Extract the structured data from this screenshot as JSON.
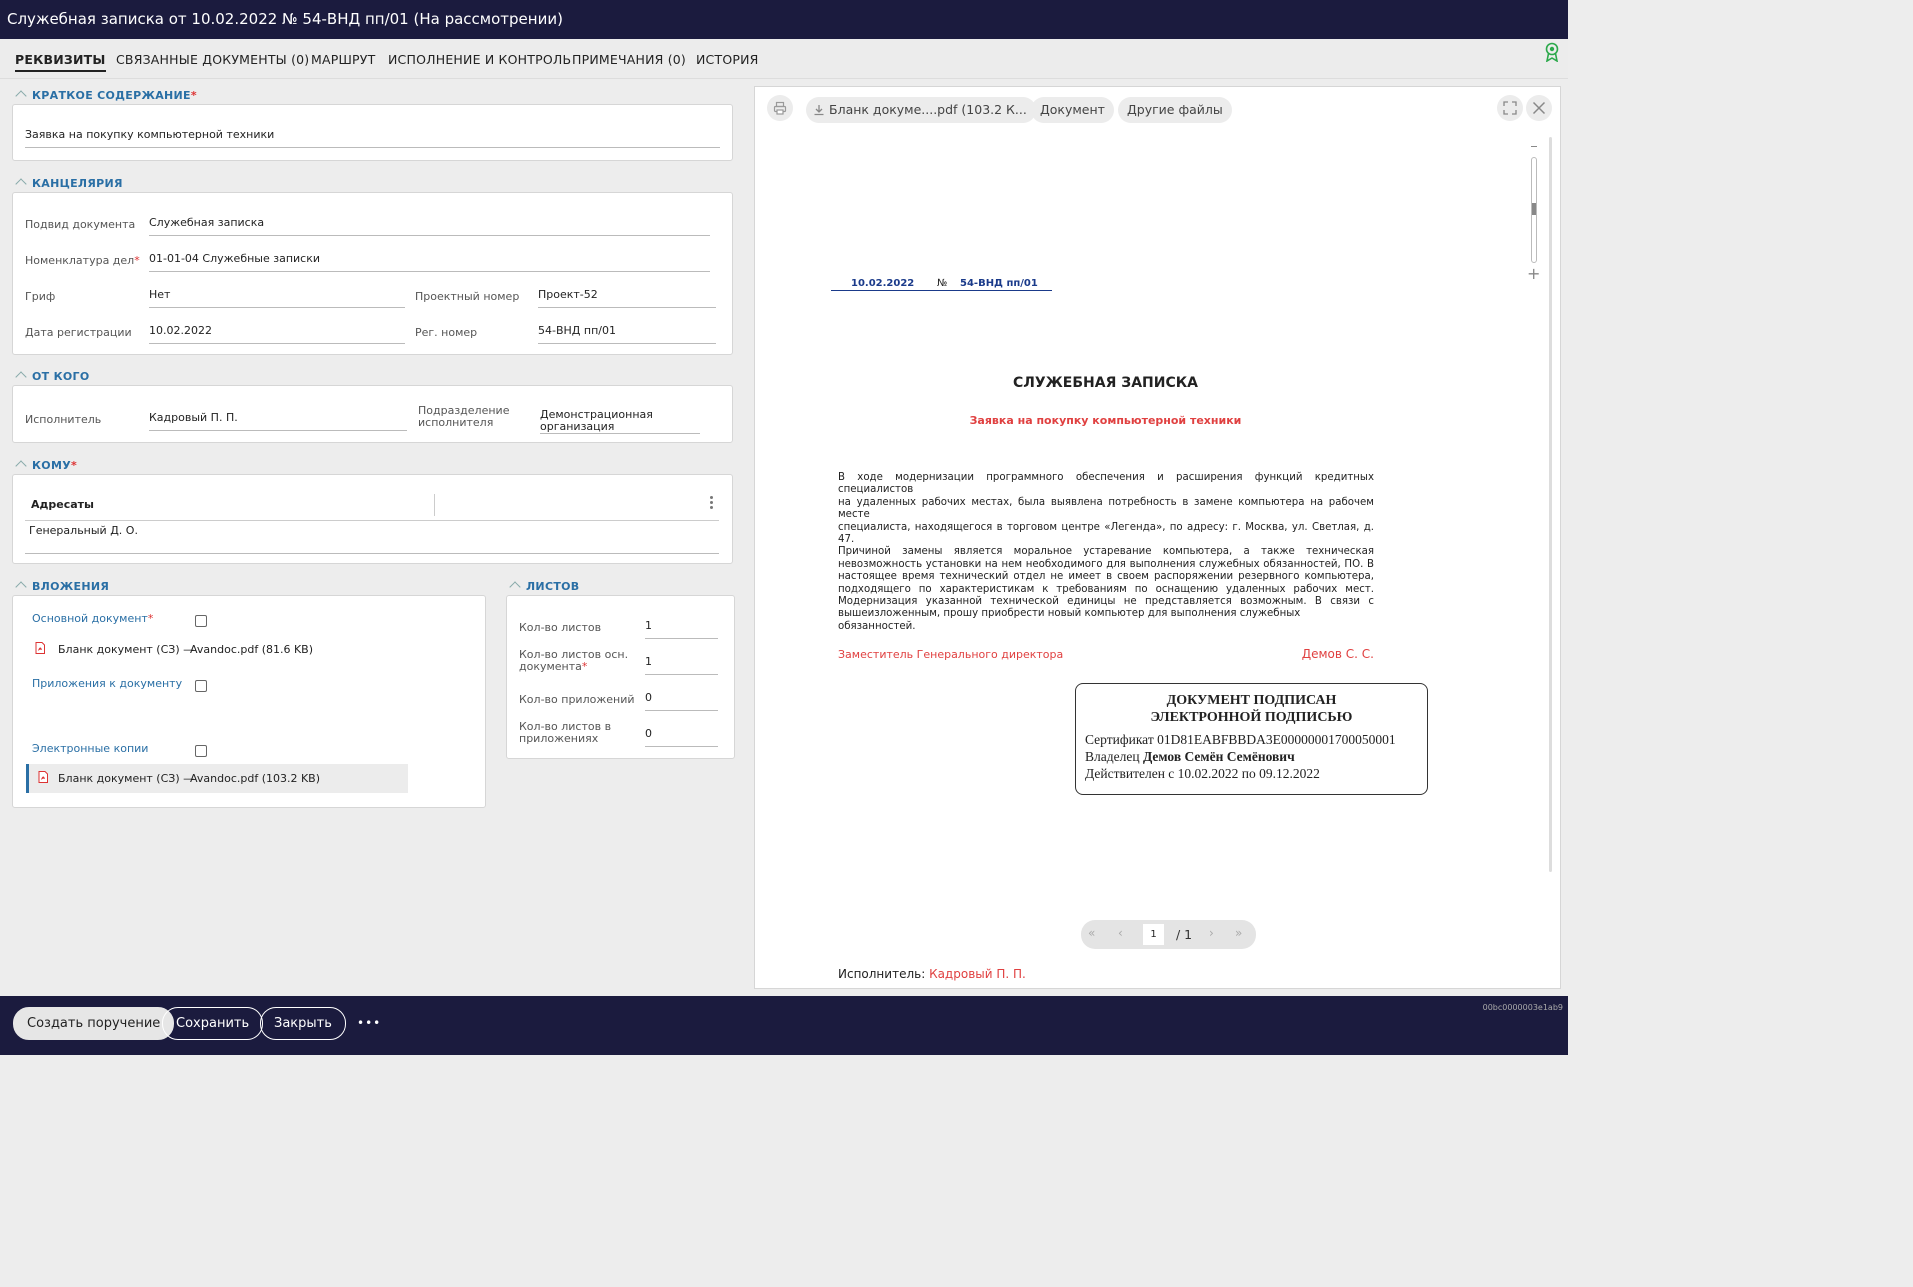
{
  "window": {
    "title": "Служебная записка от 10.02.2022 № 54-ВНД пп/01 (На рассмотрении)"
  },
  "tabs": [
    {
      "label": "РЕКВИЗИТЫ"
    },
    {
      "label": "СВЯЗАННЫЕ ДОКУМЕНТЫ (0)"
    },
    {
      "label": "МАРШРУТ"
    },
    {
      "label": "ИСПОЛНЕНИЕ И КОНТРОЛЬ"
    },
    {
      "label": "ПРИМЕЧАНИЯ (0)"
    },
    {
      "label": "ИСТОРИЯ"
    }
  ],
  "sections": {
    "summary": {
      "title": "КРАТКОЕ СОДЕРЖАНИЕ",
      "required": "*",
      "value": "Заявка на покупку компьютерной техники"
    },
    "office": {
      "title": "КАНЦЕЛЯРИЯ",
      "subtype_label": "Подвид документа",
      "subtype_value": "Служебная записка",
      "nomenclature_label": "Номенклатура дел",
      "nomenclature_value": "01-01-04 Служебные записки",
      "stamp_label": "Гриф",
      "stamp_value": "Нет",
      "project_no_label": "Проектный номер",
      "project_no_value": "Проект-52",
      "reg_date_label": "Дата регистрации",
      "reg_date_value": "10.02.2022",
      "reg_no_label": "Рег. номер",
      "reg_no_value": "54-ВНД пп/01"
    },
    "from": {
      "title": "ОТ КОГО",
      "executor_label": "Исполнитель",
      "executor_value": "Кадровый П. П.",
      "dept_label_1": "Подразделение",
      "dept_label_2": "исполнителя",
      "dept_value_1": "Демонстрационная",
      "dept_value_2": "организация"
    },
    "to": {
      "title": "КОМУ",
      "column": "Адресаты",
      "addressee": "Генеральный Д. О."
    },
    "attachments": {
      "title": "ВЛОЖЕНИЯ",
      "main_doc_label": "Основной документ",
      "main_doc_name": "Бланк документ (СЗ) —",
      "main_doc_file": "Avandoc.pdf (81.6 KB)",
      "appendix_label": "Приложения к документу",
      "ecopy_label": "Электронные копии",
      "ecopy_name": "Бланк документ (СЗ) —",
      "ecopy_file": "Avandoc.pdf (103.2 KB)"
    },
    "sheets": {
      "title": "ЛИСТОВ",
      "sheets_label": "Кол-во листов",
      "sheets_value": "1",
      "main_sheets_label_1": "Кол-во листов осн.",
      "main_sheets_label_2": "документа",
      "main_sheets_value": "1",
      "appendices_label": "Кол-во приложений",
      "appendices_value": "0",
      "appendix_sheets_label_1": "Кол-во листов в",
      "appendix_sheets_label_2": "приложениях",
      "appendix_sheets_value": "0"
    }
  },
  "viewer": {
    "file_button": "Бланк докуме....pdf (103.2 К...",
    "document_button": "Документ",
    "other_files_button": "Другие файлы",
    "page_current": "1",
    "page_total": "/ 1",
    "doc": {
      "date": "10.02.2022",
      "number_sign": "№",
      "number": "54-ВНД пп/01",
      "heading": "СЛУЖЕБНАЯ ЗАПИСКА",
      "subject": "Заявка на покупку компьютерной техники",
      "body": [
        "В ходе модернизации программного обеспечения и расширения функций кредитных специалистов",
        "на удаленных рабочих местах, была выявлена потребность в замене компьютера на рабочем месте",
        "специалиста, находящегося в торговом центре «Легенда», по адресу: г. Москва, ул. Светлая, д. 47.",
        "Причиной замены является моральное устаревание компьютера, а также техническая",
        "невозможность установки на нем необходимого для выполнения служебных обязанностей, ПО. В",
        "настоящее время технический отдел не имеет в своем распоряжении резервного компьютера,",
        "подходящего по характеристикам к требованиям по оснащению удаленных рабочих мест.",
        "Модернизация указанной технической единицы не представляется возможным. В связи с",
        "вышеизложенным, прошу приобрести новый компьютер для выполнения служебных обязанностей."
      ],
      "signer_position": "Заместитель Генерального директора",
      "signer_name": "Демов С. С.",
      "sig_title_1": "ДОКУМЕНТ ПОДПИСАН",
      "sig_title_2": "ЭЛЕКТРОННОЙ ПОДПИСЬЮ",
      "sig_cert_label": "Сертификат",
      "sig_cert": "01D81EABFBBDA3E00000001700050001",
      "sig_owner_label": "Владелец",
      "sig_owner": "Демов Семён Семёнович",
      "sig_valid": "Действителен с 10.02.2022 по 09.12.2022",
      "executor_label": "Исполнитель:",
      "executor": "Кадровый П. П."
    }
  },
  "footer": {
    "create_task": "Создать поручение",
    "save": "Сохранить",
    "close": "Закрыть",
    "more": "•••",
    "doc_id": "00bc0000003e1ab9"
  },
  "colors": {
    "header_bg": "#1b1b3e",
    "accent": "#2a6fa5",
    "required": "#d33333",
    "doc_red": "#e04040",
    "doc_blue": "#1a3a8a"
  },
  "icons": [
    "award-icon",
    "chevron-up-icon",
    "printer-icon",
    "download-icon",
    "fullscreen-icon",
    "close-icon",
    "pdf-icon",
    "kebab-icon"
  ]
}
